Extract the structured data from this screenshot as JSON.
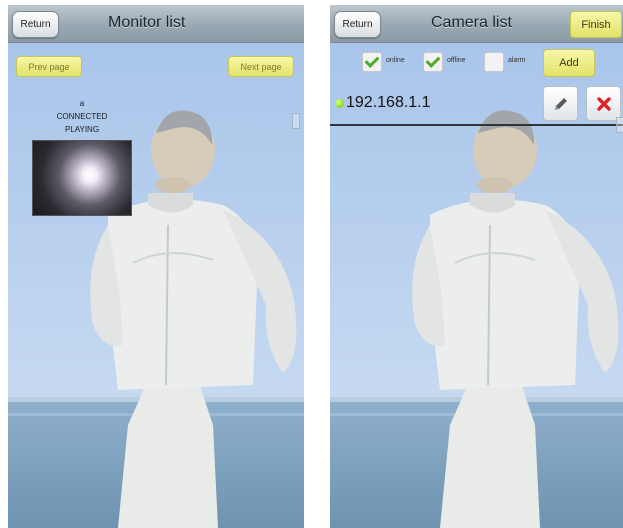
{
  "left_screen": {
    "title": "Monitor list",
    "return_label": "Return",
    "prev_page_label": "Prev page",
    "next_page_label": "Next page",
    "channel_number": "a",
    "connection_status": "CONNECTED",
    "play_status": "PLAYING"
  },
  "right_screen": {
    "title": "Camera list",
    "return_label": "Return",
    "finish_label": "Finish",
    "filters": [
      {
        "label": "online",
        "checked": true
      },
      {
        "label": "offline",
        "checked": true
      },
      {
        "label": "alarm",
        "checked": false
      }
    ],
    "add_label": "Add",
    "camera_ip": "192.168.1.1",
    "icons": {
      "edit": "pencil-icon",
      "delete": "close-x-icon",
      "status": "online-status-dot-icon"
    }
  },
  "colors": {
    "button_yellow": "#e8e87a",
    "online_green": "#7cd100",
    "delete_red": "#e0202a",
    "sky_blue": "#a9c6ea"
  }
}
